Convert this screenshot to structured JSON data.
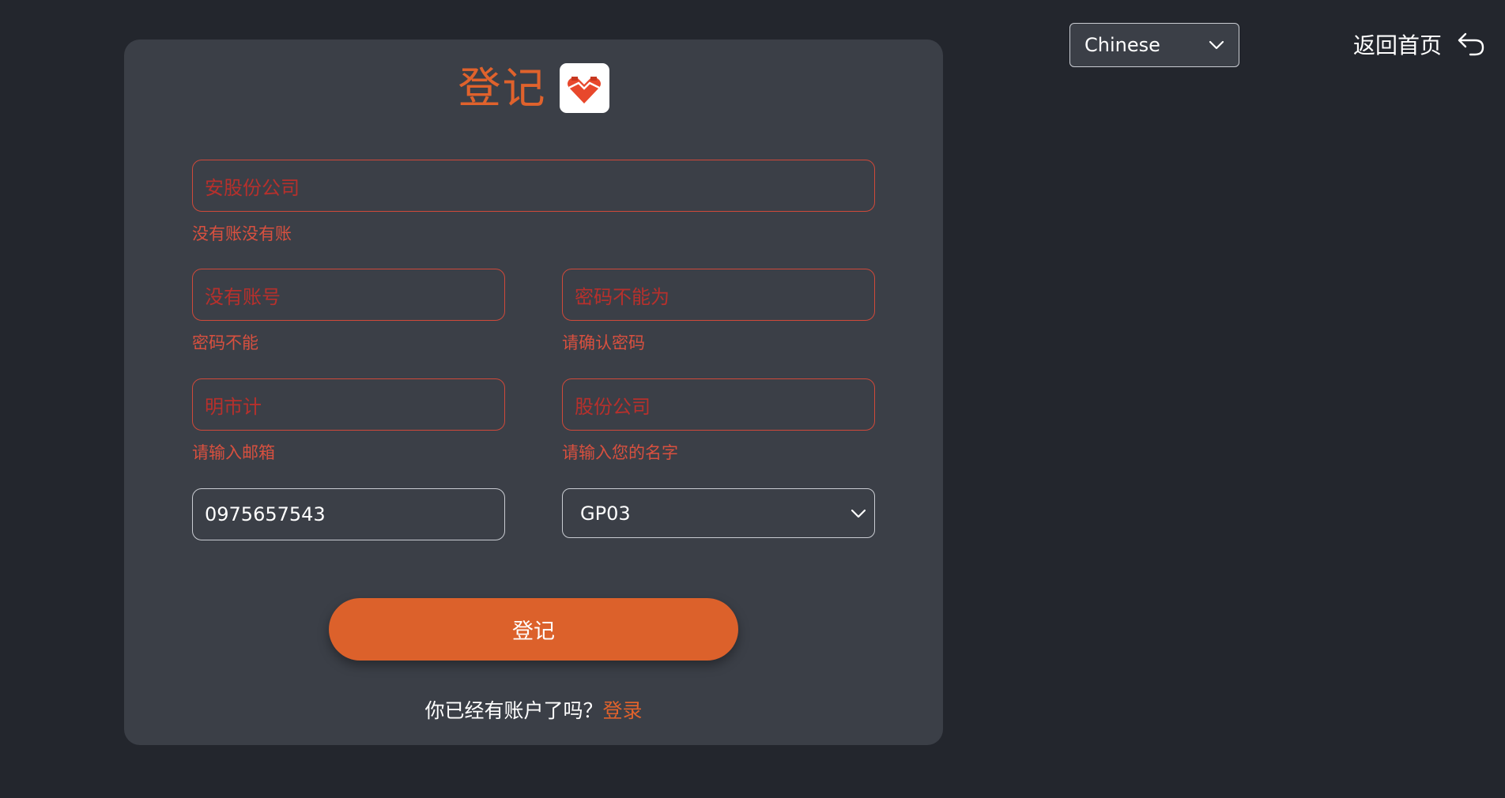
{
  "language_selector": {
    "value": "Chinese"
  },
  "back_home": {
    "label": "返回首页"
  },
  "form": {
    "title": "登记",
    "company_field": {
      "placeholder": "安股份公司",
      "error": "没有账没有账"
    },
    "username_field": {
      "placeholder": "没有账号",
      "error": "密码不能"
    },
    "password_field": {
      "placeholder": "密码不能为",
      "error": "请确认密码"
    },
    "email_field": {
      "placeholder": "明市计",
      "error": "请输入邮箱"
    },
    "name_field": {
      "placeholder": "股份公司",
      "error": "请输入您的名字"
    },
    "phone_field": {
      "value": "0975657543"
    },
    "group_select": {
      "value": "GP03"
    },
    "submit_label": "登记",
    "footer_text": "你已经有账户了吗？",
    "login_link": "登录"
  },
  "colors": {
    "accent": "#dc612b",
    "error": "#d8503f",
    "card": "#3b3f47",
    "background": "#23262d"
  }
}
